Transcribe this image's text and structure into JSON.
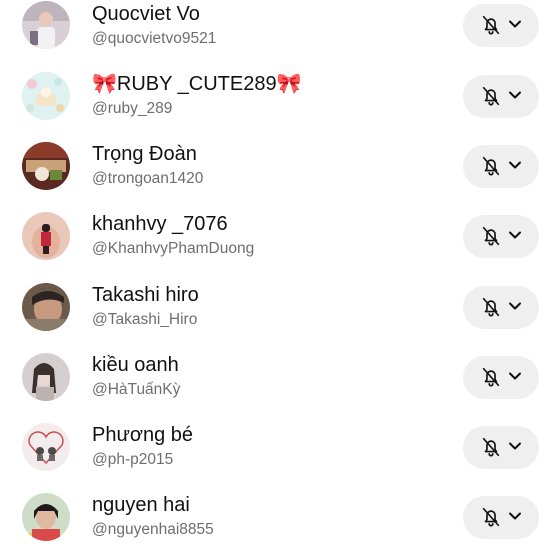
{
  "accounts": [
    {
      "name": "Quocviet Vo",
      "handle": "@quocvietvo9521",
      "avatar_icon": "profile-photo",
      "bell_icon": "bell-off-icon"
    },
    {
      "name": "🎀RUBY _CUTE289🎀",
      "handle": "@ruby_289",
      "avatar_icon": "profile-photo",
      "bell_icon": "bell-off-icon"
    },
    {
      "name": "Trọng Đoàn",
      "handle": "@trongoan1420",
      "avatar_icon": "profile-photo",
      "bell_icon": "bell-off-icon"
    },
    {
      "name": "khanhvy _7076",
      "handle": "@KhanhvyPhamDuong",
      "avatar_icon": "profile-photo",
      "bell_icon": "bell-off-icon"
    },
    {
      "name": "Takashi hiro",
      "handle": "@Takashi_Hiro",
      "avatar_icon": "profile-photo",
      "bell_icon": "bell-off-icon"
    },
    {
      "name": "kiều oanh",
      "handle": "@HàTuấnKỳ",
      "avatar_icon": "profile-photo",
      "bell_icon": "bell-off-icon"
    },
    {
      "name": "Phương bé",
      "handle": "@ph-p2015",
      "avatar_icon": "profile-photo",
      "bell_icon": "bell-off-icon"
    },
    {
      "name": "nguyen hai",
      "handle": "@nguyenhai8855",
      "avatar_icon": "profile-photo",
      "bell_icon": "bell-off-icon"
    }
  ],
  "colors": {
    "name_text": "#111111",
    "handle_text": "#6e6e6e",
    "button_bg": "#efefef",
    "icon_stroke": "#111111"
  }
}
